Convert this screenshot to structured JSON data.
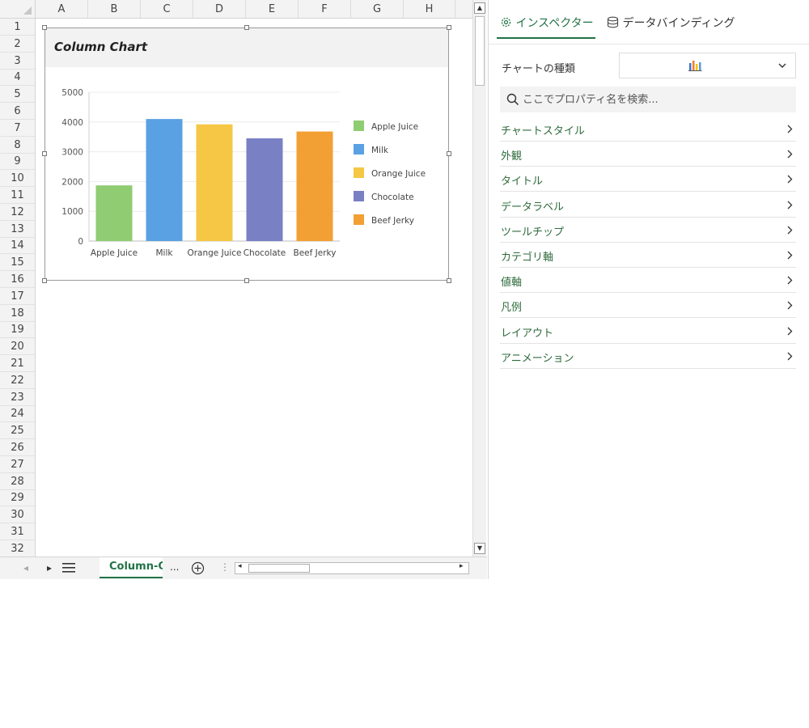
{
  "sheet": {
    "columns": [
      "A",
      "B",
      "C",
      "D",
      "E",
      "F",
      "G",
      "H"
    ],
    "rows": [
      "1",
      "2",
      "3",
      "4",
      "5",
      "6",
      "7",
      "8",
      "9",
      "10",
      "11",
      "12",
      "13",
      "14",
      "15",
      "16",
      "17",
      "18",
      "19",
      "20",
      "21",
      "22",
      "23",
      "24",
      "25",
      "26",
      "27",
      "28",
      "29",
      "30",
      "31",
      "32"
    ],
    "tab_name": "Column-C",
    "tab_more": "...",
    "tab_split": "⋮"
  },
  "chart_data": {
    "type": "bar",
    "title": "Column Chart",
    "categories": [
      "Apple Juice",
      "Milk",
      "Orange Juice",
      "Chocolate",
      "Beef Jerky"
    ],
    "values": [
      1870,
      4100,
      3920,
      3450,
      3680
    ],
    "colors": [
      "#8fcc72",
      "#5aa1e3",
      "#f5c744",
      "#7a80c4",
      "#f2a033"
    ],
    "yticks": [
      "0",
      "1000",
      "2000",
      "3000",
      "4000",
      "5000"
    ],
    "ylim": [
      0,
      5000
    ],
    "grid": true,
    "legend_position": "right",
    "legend": [
      "Apple Juice",
      "Milk",
      "Orange Juice",
      "Chocolate",
      "Beef Jerky"
    ]
  },
  "panel": {
    "tab_inspector": "インスペクター",
    "tab_binding": "データバインディング",
    "chart_type_label": "チャートの種類",
    "search_placeholder": "ここでプロパティ名を検索...",
    "accent_color": "#217346",
    "properties": [
      "チャートスタイル",
      "外観",
      "タイトル",
      "データラベル",
      "ツールチップ",
      "カテゴリ軸",
      "値軸",
      "凡例",
      "レイアウト",
      "アニメーション"
    ]
  }
}
